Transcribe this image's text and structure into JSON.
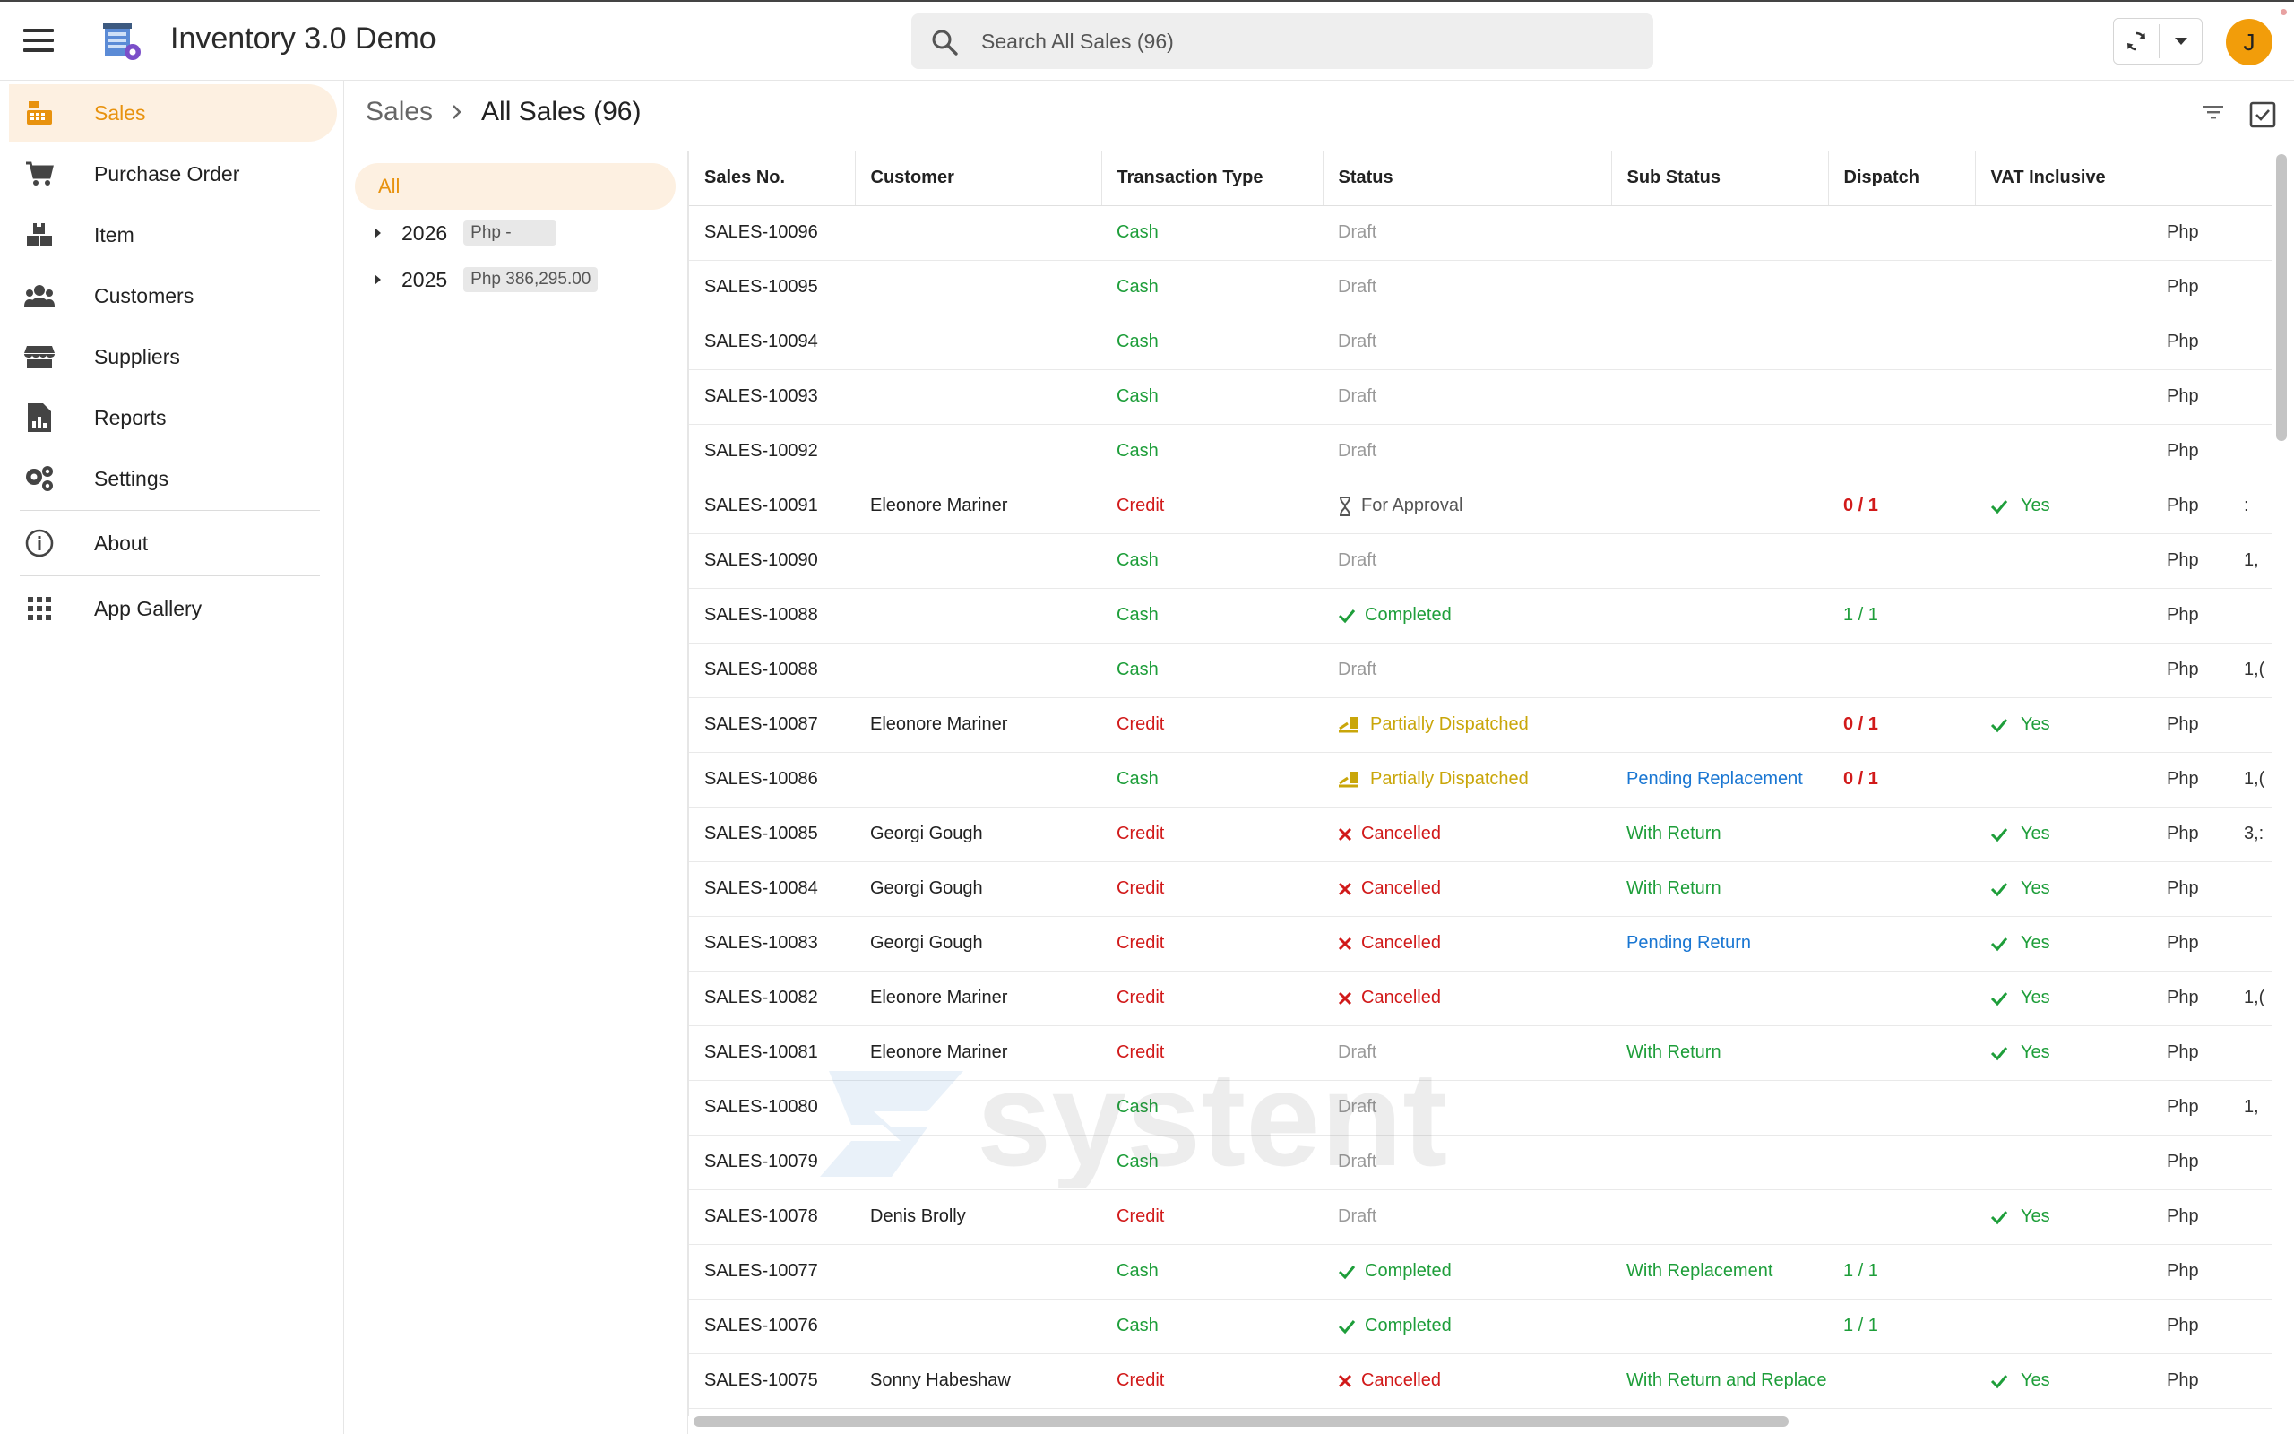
{
  "app": {
    "title": "Inventory 3.0 Demo",
    "user_initial": "J"
  },
  "search": {
    "placeholder": "Search All Sales (96)"
  },
  "sidebar": {
    "items": [
      {
        "label": "Sales",
        "icon": "cash-register-icon",
        "active": true
      },
      {
        "label": "Purchase Order",
        "icon": "cart-icon"
      },
      {
        "label": "Item",
        "icon": "boxes-icon"
      },
      {
        "label": "Customers",
        "icon": "users-icon"
      },
      {
        "label": "Suppliers",
        "icon": "store-icon"
      },
      {
        "label": "Reports",
        "icon": "report-icon"
      },
      {
        "label": "Settings",
        "icon": "gears-icon"
      },
      {
        "label": "About",
        "icon": "info-icon"
      },
      {
        "label": "App Gallery",
        "icon": "grid-icon"
      }
    ]
  },
  "breadcrumb": {
    "parent": "Sales",
    "current": "All Sales (96)"
  },
  "tree": {
    "all_label": "All",
    "years": [
      {
        "year": "2026",
        "amount": "Php  -"
      },
      {
        "year": "2025",
        "amount": "Php 386,295.00"
      }
    ]
  },
  "table": {
    "columns": [
      "Sales No.",
      "Customer",
      "Transaction Type",
      "Status",
      "Sub Status",
      "Dispatch",
      "VAT Inclusive",
      ""
    ],
    "rows": [
      {
        "no": "SALES-10096",
        "customer": "",
        "type": "Cash",
        "status": "Draft",
        "sub": "",
        "dispatch": "",
        "vat": "",
        "cur": "Php",
        "amt": ""
      },
      {
        "no": "SALES-10095",
        "customer": "",
        "type": "Cash",
        "status": "Draft",
        "sub": "",
        "dispatch": "",
        "vat": "",
        "cur": "Php",
        "amt": ""
      },
      {
        "no": "SALES-10094",
        "customer": "",
        "type": "Cash",
        "status": "Draft",
        "sub": "",
        "dispatch": "",
        "vat": "",
        "cur": "Php",
        "amt": ""
      },
      {
        "no": "SALES-10093",
        "customer": "",
        "type": "Cash",
        "status": "Draft",
        "sub": "",
        "dispatch": "",
        "vat": "",
        "cur": "Php",
        "amt": ""
      },
      {
        "no": "SALES-10092",
        "customer": "",
        "type": "Cash",
        "status": "Draft",
        "sub": "",
        "dispatch": "",
        "vat": "",
        "cur": "Php",
        "amt": ""
      },
      {
        "no": "SALES-10091",
        "customer": "Eleonore Mariner",
        "type": "Credit",
        "status": "For Approval",
        "sub": "",
        "dispatch": "0 / 1",
        "vat": "Yes",
        "cur": "Php",
        "amt": ":"
      },
      {
        "no": "SALES-10090",
        "customer": "",
        "type": "Cash",
        "status": "Draft",
        "sub": "",
        "dispatch": "",
        "vat": "",
        "cur": "Php",
        "amt": "1,"
      },
      {
        "no": "SALES-10088",
        "customer": "",
        "type": "Cash",
        "status": "Completed",
        "sub": "",
        "dispatch": "1 / 1",
        "vat": "",
        "cur": "Php",
        "amt": ""
      },
      {
        "no": "SALES-10088",
        "customer": "",
        "type": "Cash",
        "status": "Draft",
        "sub": "",
        "dispatch": "",
        "vat": "",
        "cur": "Php",
        "amt": "1,("
      },
      {
        "no": "SALES-10087",
        "customer": "Eleonore Mariner",
        "type": "Credit",
        "status": "Partially Dispatched",
        "sub": "",
        "dispatch": "0 / 1",
        "vat": "Yes",
        "cur": "Php",
        "amt": ""
      },
      {
        "no": "SALES-10086",
        "customer": "",
        "type": "Cash",
        "status": "Partially Dispatched",
        "sub": "Pending Replacement",
        "dispatch": "0 / 1",
        "vat": "",
        "cur": "Php",
        "amt": "1,("
      },
      {
        "no": "SALES-10085",
        "customer": "Georgi Gough",
        "type": "Credit",
        "status": "Cancelled",
        "sub": "With Return",
        "dispatch": "",
        "vat": "Yes",
        "cur": "Php",
        "amt": "3,:"
      },
      {
        "no": "SALES-10084",
        "customer": "Georgi Gough",
        "type": "Credit",
        "status": "Cancelled",
        "sub": "With Return",
        "dispatch": "",
        "vat": "Yes",
        "cur": "Php",
        "amt": ""
      },
      {
        "no": "SALES-10083",
        "customer": "Georgi Gough",
        "type": "Credit",
        "status": "Cancelled",
        "sub": "Pending Return",
        "dispatch": "",
        "vat": "Yes",
        "cur": "Php",
        "amt": ""
      },
      {
        "no": "SALES-10082",
        "customer": "Eleonore Mariner",
        "type": "Credit",
        "status": "Cancelled",
        "sub": "",
        "dispatch": "",
        "vat": "Yes",
        "cur": "Php",
        "amt": "1,("
      },
      {
        "no": "SALES-10081",
        "customer": "Eleonore Mariner",
        "type": "Credit",
        "status": "Draft",
        "sub": "With Return",
        "dispatch": "",
        "vat": "Yes",
        "cur": "Php",
        "amt": ""
      },
      {
        "no": "SALES-10080",
        "customer": "",
        "type": "Cash",
        "status": "Draft",
        "sub": "",
        "dispatch": "",
        "vat": "",
        "cur": "Php",
        "amt": "1,"
      },
      {
        "no": "SALES-10079",
        "customer": "",
        "type": "Cash",
        "status": "Draft",
        "sub": "",
        "dispatch": "",
        "vat": "",
        "cur": "Php",
        "amt": ""
      },
      {
        "no": "SALES-10078",
        "customer": "Denis Brolly",
        "type": "Credit",
        "status": "Draft",
        "sub": "",
        "dispatch": "",
        "vat": "Yes",
        "cur": "Php",
        "amt": ""
      },
      {
        "no": "SALES-10077",
        "customer": "",
        "type": "Cash",
        "status": "Completed",
        "sub": "With Replacement",
        "dispatch": "1 / 1",
        "vat": "",
        "cur": "Php",
        "amt": ""
      },
      {
        "no": "SALES-10076",
        "customer": "",
        "type": "Cash",
        "status": "Completed",
        "sub": "",
        "dispatch": "1 / 1",
        "vat": "",
        "cur": "Php",
        "amt": ""
      },
      {
        "no": "SALES-10075",
        "customer": "Sonny Habeshaw",
        "type": "Credit",
        "status": "Cancelled",
        "sub": "With Return and Replace",
        "dispatch": "",
        "vat": "Yes",
        "cur": "Php",
        "amt": ""
      }
    ]
  },
  "colors": {
    "accent": "#e8920e",
    "cash": "#1e9e3a",
    "credit": "#d11a1a",
    "link_blue": "#1976d2",
    "partial": "#c9a60a"
  },
  "watermark": {
    "text": "systent"
  }
}
